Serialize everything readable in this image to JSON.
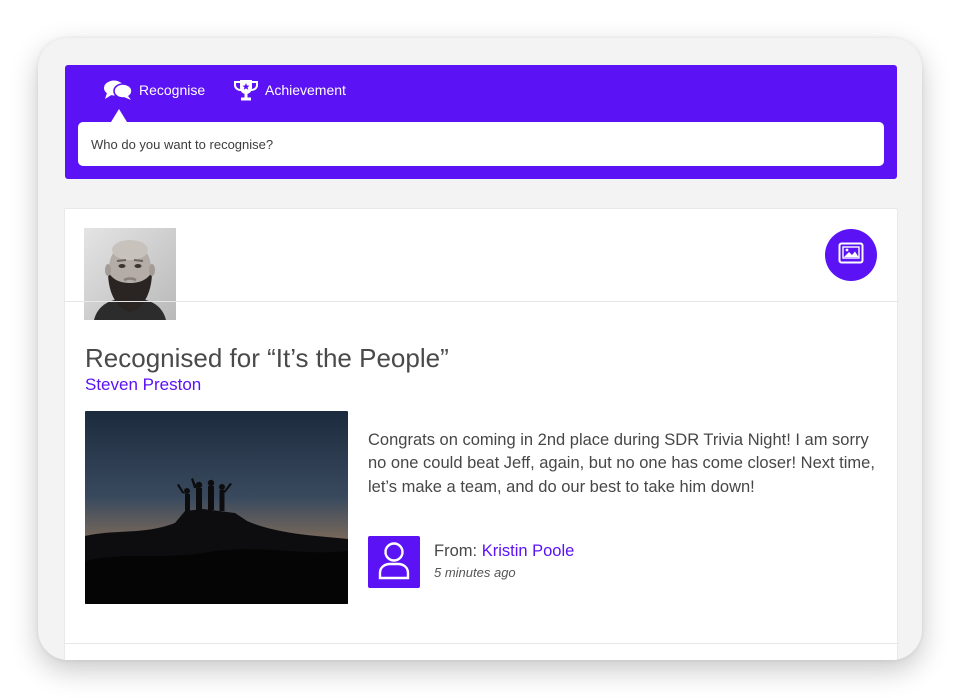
{
  "colors": {
    "accent": "#5b12f4",
    "frame_bg": "#f3f3f4",
    "card_bg": "#ffffff"
  },
  "composer": {
    "tabs": [
      {
        "label": "Recognise",
        "icon": "speech-bubbles-icon",
        "active": true
      },
      {
        "label": "Achievement",
        "icon": "trophy-icon",
        "active": false
      }
    ],
    "search_placeholder": "Who do you want to recognise?"
  },
  "post": {
    "avatar": "bearded-man-photo",
    "image_button_icon": "image-icon",
    "title": "Recognised for “It’s the People”",
    "recipient": "Steven Preston",
    "photo": "mountain-sunset-silhouette-photo",
    "message": "Congrats on coming in 2nd place during SDR Trivia Night! I am sorry no one could beat Jeff, again, but no one has come closer! Next time, let’s make a team, and do our best to take him down!",
    "from_label": "From:",
    "from_name": "Kristin Poole",
    "timestamp": "5 minutes ago",
    "sender_icon": "user-icon"
  }
}
